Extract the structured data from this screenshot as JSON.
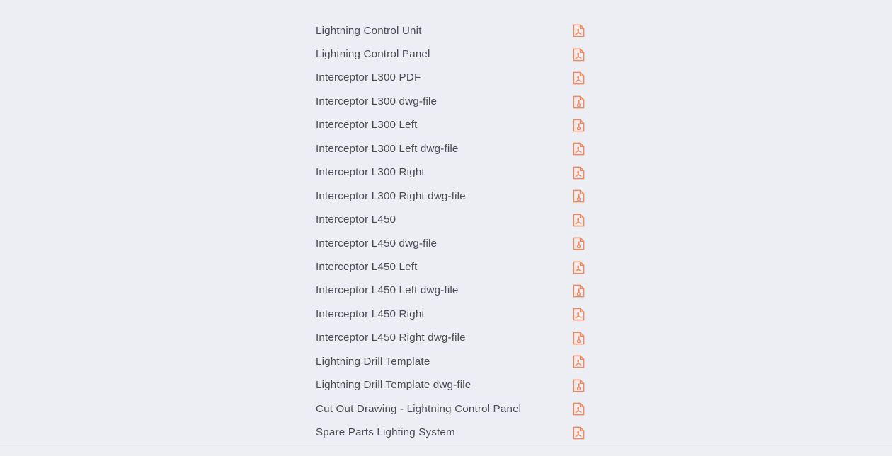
{
  "theme": {
    "background": "#eceef3",
    "text_color": "#4b4b57",
    "icon_color": "#f2895c"
  },
  "downloads": {
    "icon_names": {
      "pdf": "pdf-file-icon",
      "dwg": "dwg-file-icon"
    },
    "items": [
      {
        "label": "Lightning Control Unit",
        "icon": "pdf"
      },
      {
        "label": "Lightning Control Panel",
        "icon": "pdf"
      },
      {
        "label": "Interceptor L300 PDF",
        "icon": "pdf"
      },
      {
        "label": "Interceptor L300 dwg-file",
        "icon": "dwg"
      },
      {
        "label": "Interceptor L300 Left",
        "icon": "dwg"
      },
      {
        "label": "Interceptor L300 Left dwg-file",
        "icon": "pdf"
      },
      {
        "label": "Interceptor L300 Right",
        "icon": "pdf"
      },
      {
        "label": "Interceptor L300 Right dwg-file",
        "icon": "dwg"
      },
      {
        "label": "Interceptor L450",
        "icon": "pdf"
      },
      {
        "label": "Interceptor L450 dwg-file",
        "icon": "dwg"
      },
      {
        "label": "Interceptor L450 Left",
        "icon": "pdf"
      },
      {
        "label": "Interceptor L450 Left dwg-file",
        "icon": "dwg"
      },
      {
        "label": "Interceptor L450 Right",
        "icon": "pdf"
      },
      {
        "label": "Interceptor L450 Right dwg-file",
        "icon": "dwg"
      },
      {
        "label": "Lightning Drill Template",
        "icon": "pdf"
      },
      {
        "label": "Lightning Drill Template dwg-file",
        "icon": "dwg"
      },
      {
        "label": "Cut Out Drawing - Lightning Control Panel",
        "icon": "pdf"
      },
      {
        "label": "Spare Parts Lighting System",
        "icon": "pdf"
      }
    ]
  }
}
